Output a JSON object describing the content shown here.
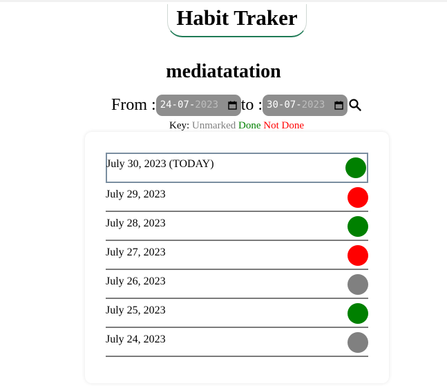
{
  "app": {
    "title": "Habit Traker"
  },
  "habit": {
    "name": "mediatatation"
  },
  "range": {
    "from_label": "From :",
    "to_label": "to :",
    "from": {
      "day": "24",
      "month": "07",
      "year": "2023"
    },
    "to": {
      "day": "30",
      "month": "07",
      "year": "2023"
    }
  },
  "key": {
    "label": "Key:",
    "unmarked": "Unmarked",
    "done": "Done",
    "not_done": "Not Done"
  },
  "status_colors": {
    "done": "#008000",
    "not_done": "#ff0000",
    "unmarked": "#808080"
  },
  "entries": [
    {
      "date": "July 30, 2023 (TODAY)",
      "status": "done",
      "today": true
    },
    {
      "date": "July 29, 2023",
      "status": "not_done",
      "today": false
    },
    {
      "date": "July 28, 2023",
      "status": "done",
      "today": false
    },
    {
      "date": "July 27, 2023",
      "status": "not_done",
      "today": false
    },
    {
      "date": "July 26, 2023",
      "status": "unmarked",
      "today": false
    },
    {
      "date": "July 25, 2023",
      "status": "done",
      "today": false
    },
    {
      "date": "July 24, 2023",
      "status": "unmarked",
      "today": false
    }
  ]
}
